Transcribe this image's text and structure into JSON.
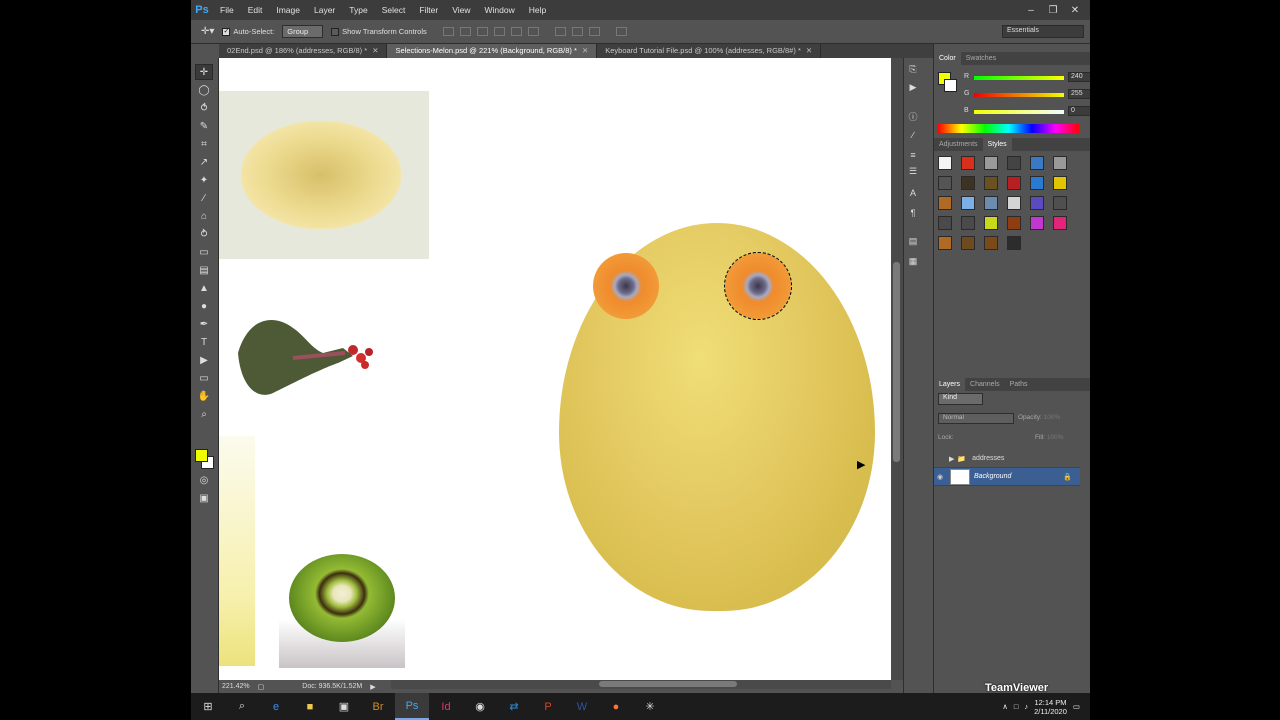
{
  "app": {
    "logo": "Ps",
    "menu": [
      "File",
      "Edit",
      "Image",
      "Layer",
      "Type",
      "Select",
      "Filter",
      "View",
      "Window",
      "Help"
    ],
    "window_controls": [
      "–",
      "❐",
      "✕"
    ]
  },
  "options": {
    "auto_select_label": "Auto-Select:",
    "auto_select_value": "Group",
    "transform_label": "Show Transform Controls",
    "workspace": "Essentials"
  },
  "tabs": [
    {
      "label": "02End.psd @ 186% (addresses, RGB/8) *",
      "active": false
    },
    {
      "label": "Selections-Melon.psd @ 221% (Background, RGB/8) *",
      "active": true
    },
    {
      "label": "Keyboard Tutorial File.psd @ 100% (addresses, RGB/8#) *",
      "active": false
    }
  ],
  "status": {
    "zoom": "221.42%",
    "doc": "Doc: 936.5K/1.52M"
  },
  "color_panel": {
    "tabs": [
      "Color",
      "Swatches"
    ],
    "r_label": "R",
    "r_value": "240",
    "g_label": "G",
    "g_value": "255",
    "b_label": "B",
    "b_value": "0",
    "foreground": "#f0ff00"
  },
  "styles_panel": {
    "tabs": [
      "Adjustments",
      "Styles"
    ],
    "swatches": [
      "#f4f4f4",
      "#d9301d",
      "#9a9a9a",
      "#444",
      "#3a79c4",
      "#999",
      "#555",
      "#3c3321",
      "#6b5020",
      "#b81f22",
      "#2a7ad1",
      "#e2c500",
      "#b06a25",
      "#7bb0e6",
      "#6c8bb0",
      "#d4d4d4",
      "#5b4bc1",
      "#4f4f4f",
      "#4a4a4a",
      "#4a4a4a",
      "#c8d91b",
      "#8e3d12",
      "#c038cf",
      "#e2257a",
      "#b06a25",
      "#6e4a20",
      "#7a4a1a",
      "#2c2c2c"
    ]
  },
  "layers_panel": {
    "tabs": [
      "Layers",
      "Channels",
      "Paths"
    ],
    "kind": "Kind",
    "blend_mode": "Normal",
    "opacity_label": "Opacity:",
    "opacity_value": "100%",
    "lock_label": "Lock:",
    "fill_label": "Fill:",
    "fill_value": "100%",
    "layers": [
      {
        "name": "addresses",
        "type": "group",
        "selected": false
      },
      {
        "name": "Background",
        "type": "image",
        "selected": true
      }
    ]
  },
  "taskbar": {
    "time": "12:14 PM",
    "date": "2/11/2020",
    "watermark": "TeamViewer",
    "apps": [
      "start",
      "search",
      "edge",
      "explorer",
      "store",
      "bridge",
      "photoshop",
      "indesign",
      "chrome",
      "teamviewer",
      "powerpoint",
      "word",
      "firefox",
      "loading"
    ]
  }
}
